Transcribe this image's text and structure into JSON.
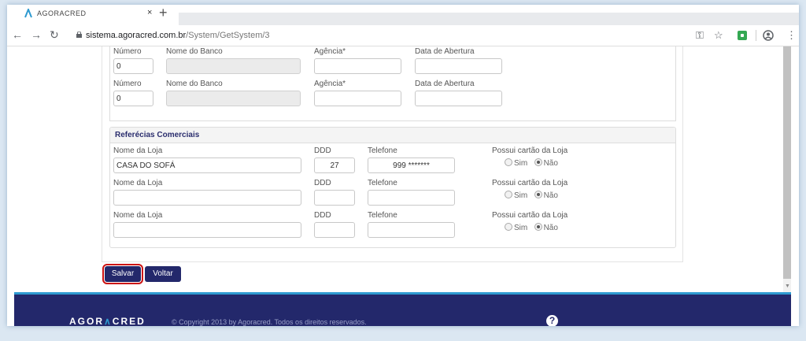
{
  "browser": {
    "tab_title": "AGORACRED",
    "tab_close": "×",
    "new_tab": "+",
    "url_host": "sistema.agoracred.com.br",
    "url_path": "/System/GetSystem/3"
  },
  "bank_rows": [
    {
      "numero_label": "Número",
      "numero_value": "0",
      "banco_label": "Nome do Banco",
      "banco_value": "",
      "agencia_label": "Agência*",
      "agencia_value": "",
      "abertura_label": "Data de Abertura",
      "abertura_value": ""
    },
    {
      "numero_label": "Número",
      "numero_value": "0",
      "banco_label": "Nome do Banco",
      "banco_value": "",
      "agencia_label": "Agência*",
      "agencia_value": "",
      "abertura_label": "Data de Abertura",
      "abertura_value": ""
    }
  ],
  "referencias": {
    "title": "Referécias Comerciais",
    "rows": [
      {
        "loja_label": "Nome da Loja",
        "loja_value": "CASA DO SOFÁ",
        "ddd_label": "DDD",
        "ddd_value": "27",
        "telefone_label": "Telefone",
        "telefone_value": "999 *******",
        "cartao_label": "Possui cartão da Loja",
        "sim_label": "Sim",
        "nao_label": "Não",
        "selected": "Não"
      },
      {
        "loja_label": "Nome da Loja",
        "loja_value": "",
        "ddd_label": "DDD",
        "ddd_value": "",
        "telefone_label": "Telefone",
        "telefone_value": "",
        "cartao_label": "Possui cartão da Loja",
        "sim_label": "Sim",
        "nao_label": "Não",
        "selected": "Não"
      },
      {
        "loja_label": "Nome da Loja",
        "loja_value": "",
        "ddd_label": "DDD",
        "ddd_value": "",
        "telefone_label": "Telefone",
        "telefone_value": "",
        "cartao_label": "Possui cartão da Loja",
        "sim_label": "Sim",
        "nao_label": "Não",
        "selected": "Não"
      }
    ]
  },
  "actions": {
    "save_label": "Salvar",
    "back_label": "Voltar"
  },
  "footer": {
    "brand_a": "AGOR",
    "brand_b": "CRED",
    "copyright": "© Copyright 2013 by Agoracred. Todos os direitos reservados.",
    "help_glyph": "?"
  },
  "colors": {
    "brand_navy": "#23286b",
    "accent_blue": "#2e9ad0",
    "focus_red": "#cc1111"
  }
}
